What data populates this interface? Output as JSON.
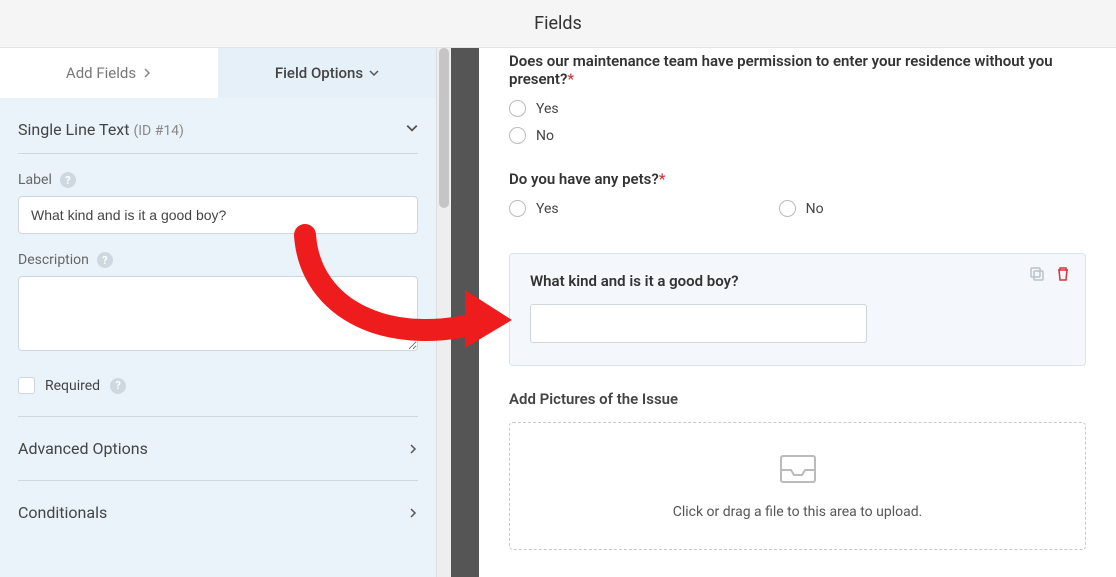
{
  "header": {
    "title": "Fields"
  },
  "tabs": {
    "add": "Add Fields",
    "options": "Field Options"
  },
  "field_editor": {
    "type_name": "Single Line Text",
    "id_label": "(ID #14)",
    "label_heading": "Label",
    "label_value": "What kind and is it a good boy?",
    "description_heading": "Description",
    "description_value": "",
    "required_label": "Required",
    "advanced_label": "Advanced Options",
    "conditionals_label": "Conditionals"
  },
  "preview": {
    "q1": {
      "label": "Does our maintenance team have permission to enter your residence without you present?",
      "opts": [
        "Yes",
        "No"
      ]
    },
    "q2": {
      "label": "Do you have any pets?",
      "opts": [
        "Yes",
        "No"
      ]
    },
    "selected": {
      "label": "What kind and is it a good boy?"
    },
    "upload": {
      "label": "Add Pictures of the Issue",
      "hint": "Click or drag a file to this area to upload."
    }
  }
}
